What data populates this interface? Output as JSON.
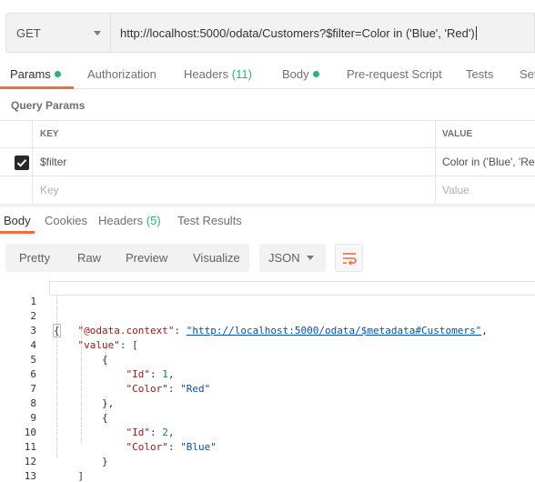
{
  "request": {
    "method": "GET",
    "url": "http://localhost:5000/odata/Customers?$filter=Color in ('Blue', 'Red')"
  },
  "request_tabs": [
    {
      "label": "Params",
      "dot": true
    },
    {
      "label": "Authorization"
    },
    {
      "label": "Headers",
      "count": "(11)"
    },
    {
      "label": "Body",
      "dot": true
    },
    {
      "label": "Pre-request Script"
    },
    {
      "label": "Tests"
    },
    {
      "label": "Set"
    }
  ],
  "query_params": {
    "title": "Query Params",
    "columns": {
      "key": "KEY",
      "value": "VALUE"
    },
    "rows": [
      {
        "checked": true,
        "key": "$filter",
        "value": "Color in ('Blue', 'Re"
      }
    ],
    "new_row": {
      "key_placeholder": "Key",
      "value_placeholder": "Value"
    }
  },
  "response_tabs": [
    {
      "label": "Body"
    },
    {
      "label": "Cookies"
    },
    {
      "label": "Headers",
      "count": "(5)"
    },
    {
      "label": "Test Results"
    }
  ],
  "response_toolbar": {
    "views": [
      "Pretty",
      "Raw",
      "Preview",
      "Visualize"
    ],
    "format": "JSON",
    "wrap_icon": "wrap-lines-icon"
  },
  "response_body": {
    "line_numbers": [
      "1",
      "2",
      "3",
      "4",
      "5",
      "6",
      "7",
      "8",
      "9",
      "10",
      "11",
      "12",
      "13"
    ],
    "context_key": "\"@odata.context\"",
    "context_value": "\"http://localhost:5000/odata/$metadata#Customers\"",
    "value_key": "\"value\"",
    "items": [
      {
        "id_key": "\"Id\"",
        "id": "1",
        "color_key": "\"Color\"",
        "color": "\"Red\""
      },
      {
        "id_key": "\"Id\"",
        "id": "2",
        "color_key": "\"Color\"",
        "color": "\"Blue\""
      }
    ]
  },
  "colors": {
    "accent": "#f26b3a",
    "status_dot": "#26b47f",
    "json_key": "#a31515",
    "json_string": "#0451a5",
    "json_number": "#098658"
  }
}
